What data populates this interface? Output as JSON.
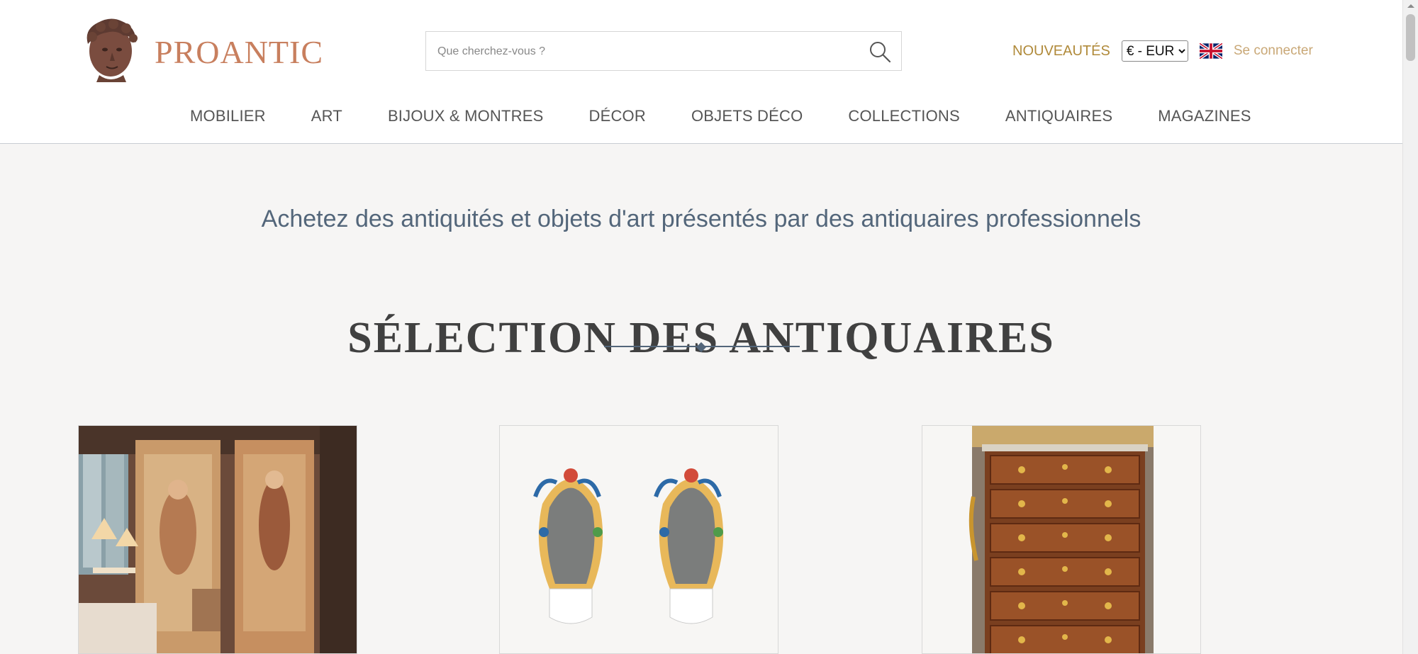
{
  "header": {
    "logo_text": "PROANTIC",
    "search": {
      "placeholder": "Que cherchez-vous ?",
      "value": ""
    },
    "new_link": "NOUVEAUTÉS",
    "currency": {
      "selected": "€ - EUR"
    },
    "language_flag": "uk-flag-icon",
    "login_link": "Se connecter"
  },
  "nav": {
    "items": [
      {
        "label": "MOBILIER"
      },
      {
        "label": "ART"
      },
      {
        "label": "BIJOUX & MONTRES"
      },
      {
        "label": "DÉCOR"
      },
      {
        "label": "OBJETS DÉCO"
      },
      {
        "label": "COLLECTIONS"
      },
      {
        "label": "ANTIQUAIRES"
      },
      {
        "label": "MAGAZINES"
      }
    ]
  },
  "main": {
    "tagline": "Achetez des antiquités et objets d'art présentés par des antiquaires professionnels",
    "section_title": "SÉLECTION DES ANTIQUAIRES",
    "products": [
      {
        "image": "painted-boiserie-panels-image"
      },
      {
        "image": "pair-of-faience-mirror-sconces-image"
      },
      {
        "image": "mahogany-chest-of-drawers-image"
      }
    ]
  },
  "colors": {
    "accent_gold": "#b08a3a",
    "logo_copper": "#c87f5e",
    "tagline_blue": "#53667a",
    "background": "#f6f5f4"
  }
}
